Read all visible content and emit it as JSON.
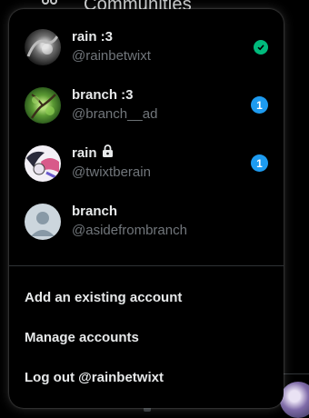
{
  "background": {
    "nav_label": "Communities",
    "nav_icon": "people-icon"
  },
  "accounts": [
    {
      "name": "rain :3",
      "handle": "@rainbetwixt",
      "status": "active",
      "status_icon": "check-icon",
      "status_color": "#00ba7c"
    },
    {
      "name": "branch :3",
      "handle": "@branch__ad",
      "badge": "1",
      "badge_color": "#1d9bf0"
    },
    {
      "name": "rain",
      "handle": "@twixtberain",
      "locked_icon": "lock-icon",
      "badge": "1",
      "badge_color": "#1d9bf0"
    },
    {
      "name": "branch",
      "handle": "@asidefrombranch",
      "avatar": "default-avatar-icon"
    }
  ],
  "actions": {
    "add_account": "Add an existing account",
    "manage_accounts": "Manage accounts",
    "log_out": "Log out @rainbetwixt"
  },
  "colors": {
    "background": "#000000",
    "text_primary": "#e7e9ea",
    "text_secondary": "#71767b",
    "divider": "#2f3336"
  }
}
